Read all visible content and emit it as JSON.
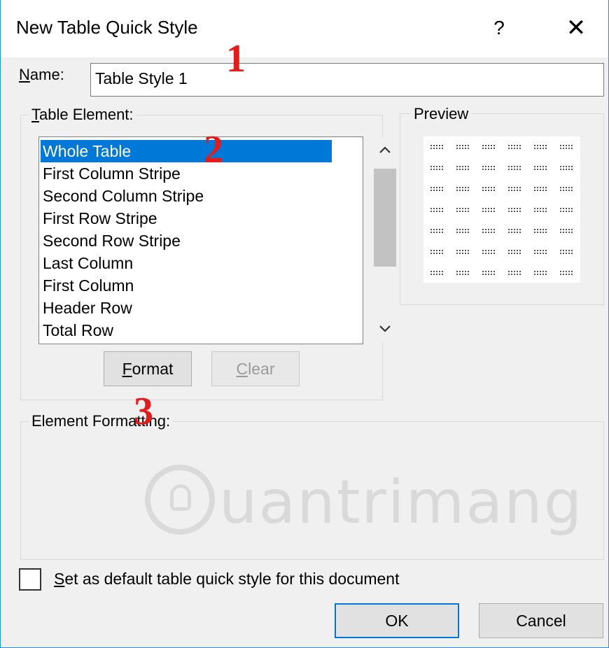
{
  "window": {
    "title": "New Table Quick Style",
    "help_label": "?",
    "close_label": "✕"
  },
  "name_field": {
    "label_accel": "N",
    "label_rest": "ame:",
    "value": "Table Style 1"
  },
  "table_element": {
    "title_accel": "T",
    "title_rest": "able Element:",
    "items": [
      "Whole Table",
      "First Column Stripe",
      "Second Column Stripe",
      "First Row Stripe",
      "Second Row Stripe",
      "Last Column",
      "First Column",
      "Header Row",
      "Total Row"
    ],
    "selected_index": 0,
    "format_button": {
      "accel": "F",
      "rest": "ormat"
    },
    "clear_button": {
      "accel": "C",
      "rest": "lear"
    }
  },
  "preview": {
    "title": "Preview",
    "rows": 7,
    "cols": 6
  },
  "element_formatting": {
    "title": "Element Formatting:"
  },
  "default_checkbox": {
    "label_accel": "S",
    "label_rest": "et as default table quick style for this document",
    "checked": false
  },
  "buttons": {
    "ok": "OK",
    "cancel": "Cancel"
  },
  "annotations": [
    "1",
    "2",
    "3"
  ],
  "watermark": {
    "text": "uantrimang"
  },
  "colors": {
    "accent": "#0078d7",
    "annotation": "#e41b1b"
  },
  "icons": {
    "close": "close-icon",
    "help": "help-icon",
    "scroll_up": "chevron-up-icon",
    "scroll_down": "chevron-down-icon"
  }
}
